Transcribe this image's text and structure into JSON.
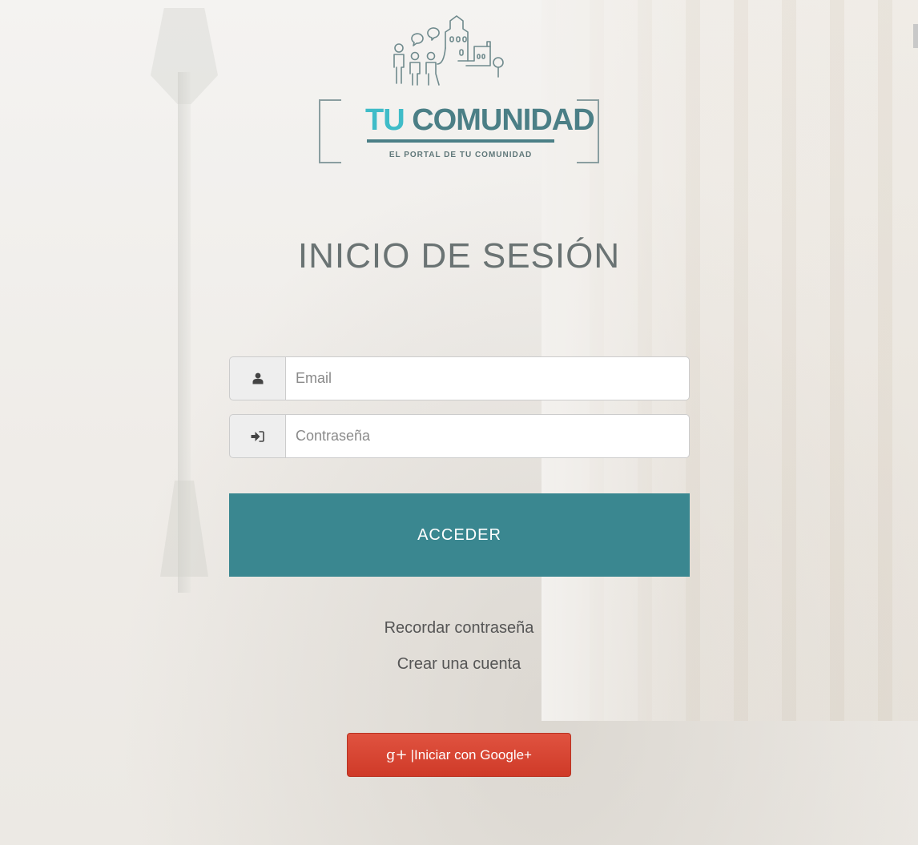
{
  "brand": {
    "name_part1": "TU",
    "name_part2": "COMUNIDAD",
    "tagline": "EL PORTAL DE TU COMUNIDAD",
    "accent_color": "#3fbcc8",
    "primary_color": "#4b7f86"
  },
  "login": {
    "title": "INICIO DE SESIÓN",
    "email": {
      "icon": "user-icon",
      "placeholder": "Email",
      "value": ""
    },
    "password": {
      "icon": "sign-in-icon",
      "placeholder": "Contraseña",
      "value": ""
    },
    "submit_label": "ACCEDER",
    "submit_color": "#3a8790"
  },
  "links": {
    "remember_password": "Recordar contraseña",
    "create_account": "Crear una cuenta"
  },
  "social": {
    "google_icon": "google-plus-icon",
    "google_icon_glyph": "g+",
    "google_label": "|Iniciar con Google+",
    "google_color": "#d9432f"
  }
}
